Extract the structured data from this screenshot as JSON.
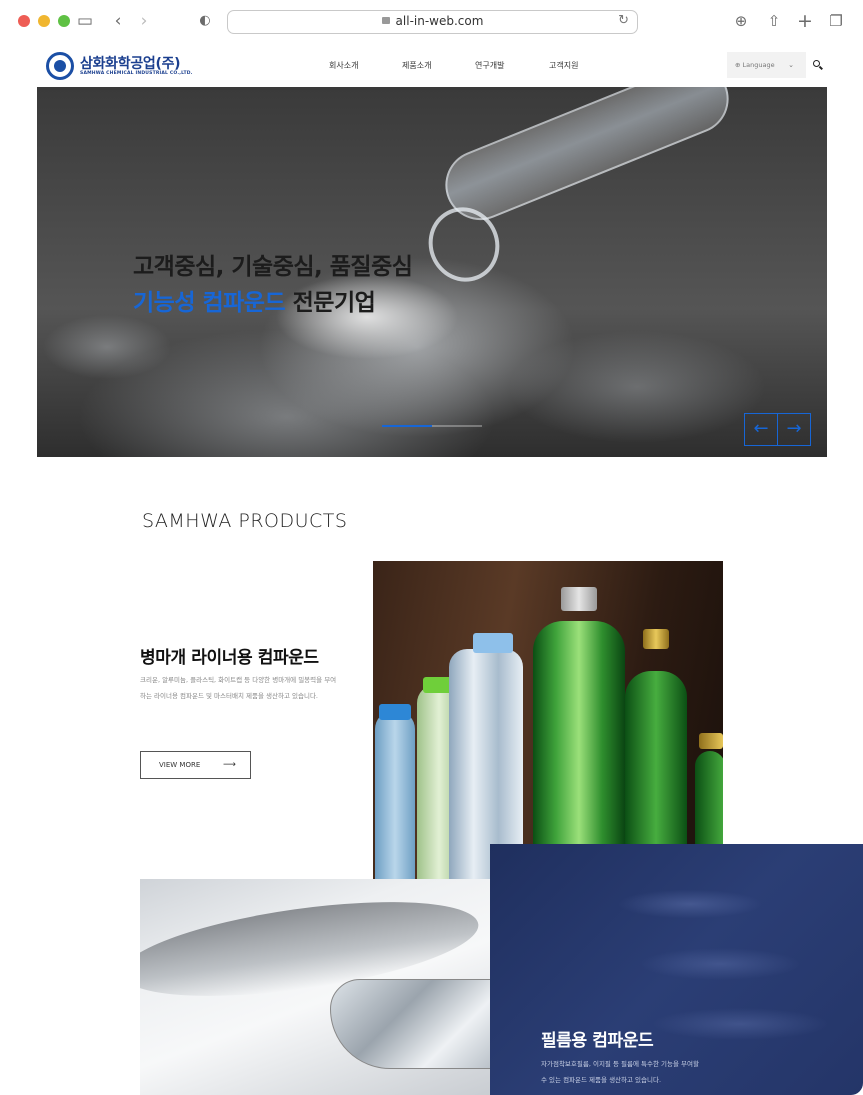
{
  "browser": {
    "url": "all-in-web.com"
  },
  "header": {
    "logo_ko": "삼화화학공업(주)",
    "logo_en": "SAMHWA CHEMICAL INDUSTRIAL CO.,LTD.",
    "nav": [
      "회사소개",
      "제품소개",
      "연구개발",
      "고객지원"
    ],
    "language_label": "Language"
  },
  "hero": {
    "line1": "고객중심, 기술중심, 품질중심",
    "line2_highlight": "기능성 컴파운드",
    "line2_rest": " 전문기업",
    "progress": 0.5,
    "prev_label": "←",
    "next_label": "→",
    "accent": "#1766d6"
  },
  "products": {
    "section_title": "SAMHWA PRODUCTS",
    "items": [
      {
        "title": "병마개 라이너용 컴파운드",
        "desc": "크리운, 알루미늄, 플라스틱, 화이트캡 등 다양한 병마개에 밀봉력을 부여하는 라이너용 컴파운드 및 마스터배치 제품을 생산하고 있습니다.",
        "button": "VIEW MORE"
      },
      {
        "title": "필름용 컴파운드",
        "desc": "자가점착보호필름, 이지필 등 필름에 특수한 기능을 부여할 수 있는 컴파운드 제품을 생산하고 있습니다."
      }
    ]
  }
}
